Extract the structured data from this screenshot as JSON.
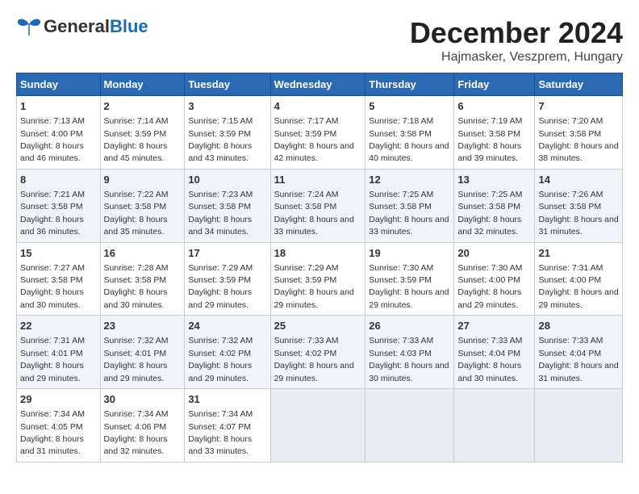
{
  "header": {
    "logo_general": "General",
    "logo_blue": "Blue",
    "title": "December 2024",
    "subtitle": "Hajmasker, Veszprem, Hungary"
  },
  "calendar": {
    "month": "December 2024",
    "location": "Hajmasker, Veszprem, Hungary",
    "days_of_week": [
      "Sunday",
      "Monday",
      "Tuesday",
      "Wednesday",
      "Thursday",
      "Friday",
      "Saturday"
    ],
    "weeks": [
      [
        {
          "day": 1,
          "sunrise": "7:13 AM",
          "sunset": "4:00 PM",
          "daylight": "8 hours and 46 minutes."
        },
        {
          "day": 2,
          "sunrise": "7:14 AM",
          "sunset": "3:59 PM",
          "daylight": "8 hours and 45 minutes."
        },
        {
          "day": 3,
          "sunrise": "7:15 AM",
          "sunset": "3:59 PM",
          "daylight": "8 hours and 43 minutes."
        },
        {
          "day": 4,
          "sunrise": "7:17 AM",
          "sunset": "3:59 PM",
          "daylight": "8 hours and 42 minutes."
        },
        {
          "day": 5,
          "sunrise": "7:18 AM",
          "sunset": "3:58 PM",
          "daylight": "8 hours and 40 minutes."
        },
        {
          "day": 6,
          "sunrise": "7:19 AM",
          "sunset": "3:58 PM",
          "daylight": "8 hours and 39 minutes."
        },
        {
          "day": 7,
          "sunrise": "7:20 AM",
          "sunset": "3:58 PM",
          "daylight": "8 hours and 38 minutes."
        }
      ],
      [
        {
          "day": 8,
          "sunrise": "7:21 AM",
          "sunset": "3:58 PM",
          "daylight": "8 hours and 36 minutes."
        },
        {
          "day": 9,
          "sunrise": "7:22 AM",
          "sunset": "3:58 PM",
          "daylight": "8 hours and 35 minutes."
        },
        {
          "day": 10,
          "sunrise": "7:23 AM",
          "sunset": "3:58 PM",
          "daylight": "8 hours and 34 minutes."
        },
        {
          "day": 11,
          "sunrise": "7:24 AM",
          "sunset": "3:58 PM",
          "daylight": "8 hours and 33 minutes."
        },
        {
          "day": 12,
          "sunrise": "7:25 AM",
          "sunset": "3:58 PM",
          "daylight": "8 hours and 33 minutes."
        },
        {
          "day": 13,
          "sunrise": "7:25 AM",
          "sunset": "3:58 PM",
          "daylight": "8 hours and 32 minutes."
        },
        {
          "day": 14,
          "sunrise": "7:26 AM",
          "sunset": "3:58 PM",
          "daylight": "8 hours and 31 minutes."
        }
      ],
      [
        {
          "day": 15,
          "sunrise": "7:27 AM",
          "sunset": "3:58 PM",
          "daylight": "8 hours and 30 minutes."
        },
        {
          "day": 16,
          "sunrise": "7:28 AM",
          "sunset": "3:58 PM",
          "daylight": "8 hours and 30 minutes."
        },
        {
          "day": 17,
          "sunrise": "7:29 AM",
          "sunset": "3:59 PM",
          "daylight": "8 hours and 29 minutes."
        },
        {
          "day": 18,
          "sunrise": "7:29 AM",
          "sunset": "3:59 PM",
          "daylight": "8 hours and 29 minutes."
        },
        {
          "day": 19,
          "sunrise": "7:30 AM",
          "sunset": "3:59 PM",
          "daylight": "8 hours and 29 minutes."
        },
        {
          "day": 20,
          "sunrise": "7:30 AM",
          "sunset": "4:00 PM",
          "daylight": "8 hours and 29 minutes."
        },
        {
          "day": 21,
          "sunrise": "7:31 AM",
          "sunset": "4:00 PM",
          "daylight": "8 hours and 29 minutes."
        }
      ],
      [
        {
          "day": 22,
          "sunrise": "7:31 AM",
          "sunset": "4:01 PM",
          "daylight": "8 hours and 29 minutes."
        },
        {
          "day": 23,
          "sunrise": "7:32 AM",
          "sunset": "4:01 PM",
          "daylight": "8 hours and 29 minutes."
        },
        {
          "day": 24,
          "sunrise": "7:32 AM",
          "sunset": "4:02 PM",
          "daylight": "8 hours and 29 minutes."
        },
        {
          "day": 25,
          "sunrise": "7:33 AM",
          "sunset": "4:02 PM",
          "daylight": "8 hours and 29 minutes."
        },
        {
          "day": 26,
          "sunrise": "7:33 AM",
          "sunset": "4:03 PM",
          "daylight": "8 hours and 30 minutes."
        },
        {
          "day": 27,
          "sunrise": "7:33 AM",
          "sunset": "4:04 PM",
          "daylight": "8 hours and 30 minutes."
        },
        {
          "day": 28,
          "sunrise": "7:33 AM",
          "sunset": "4:04 PM",
          "daylight": "8 hours and 31 minutes."
        }
      ],
      [
        {
          "day": 29,
          "sunrise": "7:34 AM",
          "sunset": "4:05 PM",
          "daylight": "8 hours and 31 minutes."
        },
        {
          "day": 30,
          "sunrise": "7:34 AM",
          "sunset": "4:06 PM",
          "daylight": "8 hours and 32 minutes."
        },
        {
          "day": 31,
          "sunrise": "7:34 AM",
          "sunset": "4:07 PM",
          "daylight": "8 hours and 33 minutes."
        },
        null,
        null,
        null,
        null
      ]
    ]
  }
}
